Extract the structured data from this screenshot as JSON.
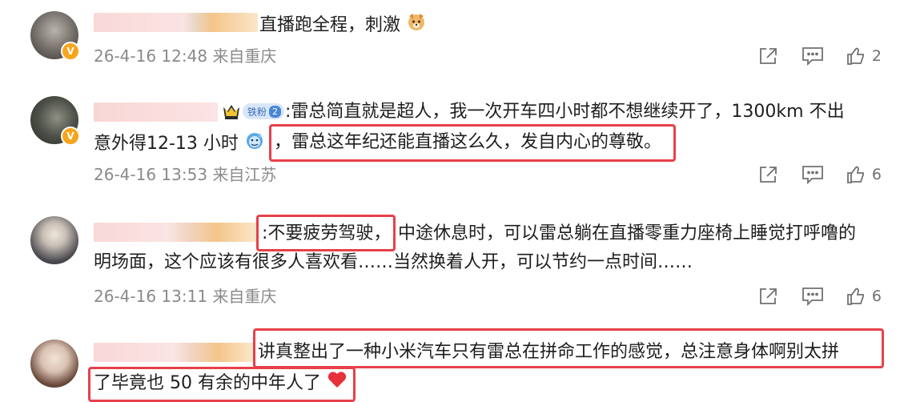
{
  "comments": [
    {
      "text_lines": [
        "直播跑全程，刺激"
      ],
      "emoji": "dog-face",
      "date": "26-4-16 12:48",
      "location": "来自重庆",
      "likes": "2"
    },
    {
      "fan_badge": "铁粉",
      "fan_level": "2",
      "text_lines": [
        ":雷总简直就是超人，我一次开车四小时都不想继续开了，1300km 不出",
        "意外得12-13 小时",
        "，雷总这年纪还能直播这么久，发自内心的尊敬。"
      ],
      "emoji": "sweat-face",
      "date": "26-4-16 13:53",
      "location": "来自江苏",
      "likes": "6"
    },
    {
      "text_lines": [
        ":不要疲劳驾驶，",
        "中途休息时，可以雷总躺在直播零重力座椅上睡觉打呼噜的",
        "明场面，这个应该有很多人喜欢看……当然换着人开，可以节约一点时间……"
      ],
      "date": "26-4-16 13:11",
      "location": "来自重庆",
      "likes": "6"
    },
    {
      "text_lines": [
        "讲真整出了一种小米汽车只有雷总在拼命工作的感觉，总注意身体啊别太拼",
        "了毕竟也 50 有余的中年人了"
      ],
      "emoji": "red-heart"
    }
  ],
  "colors": {
    "highlight": "#e8404a",
    "meta_text": "#8a8a8a",
    "verified": "#f7a51c"
  }
}
